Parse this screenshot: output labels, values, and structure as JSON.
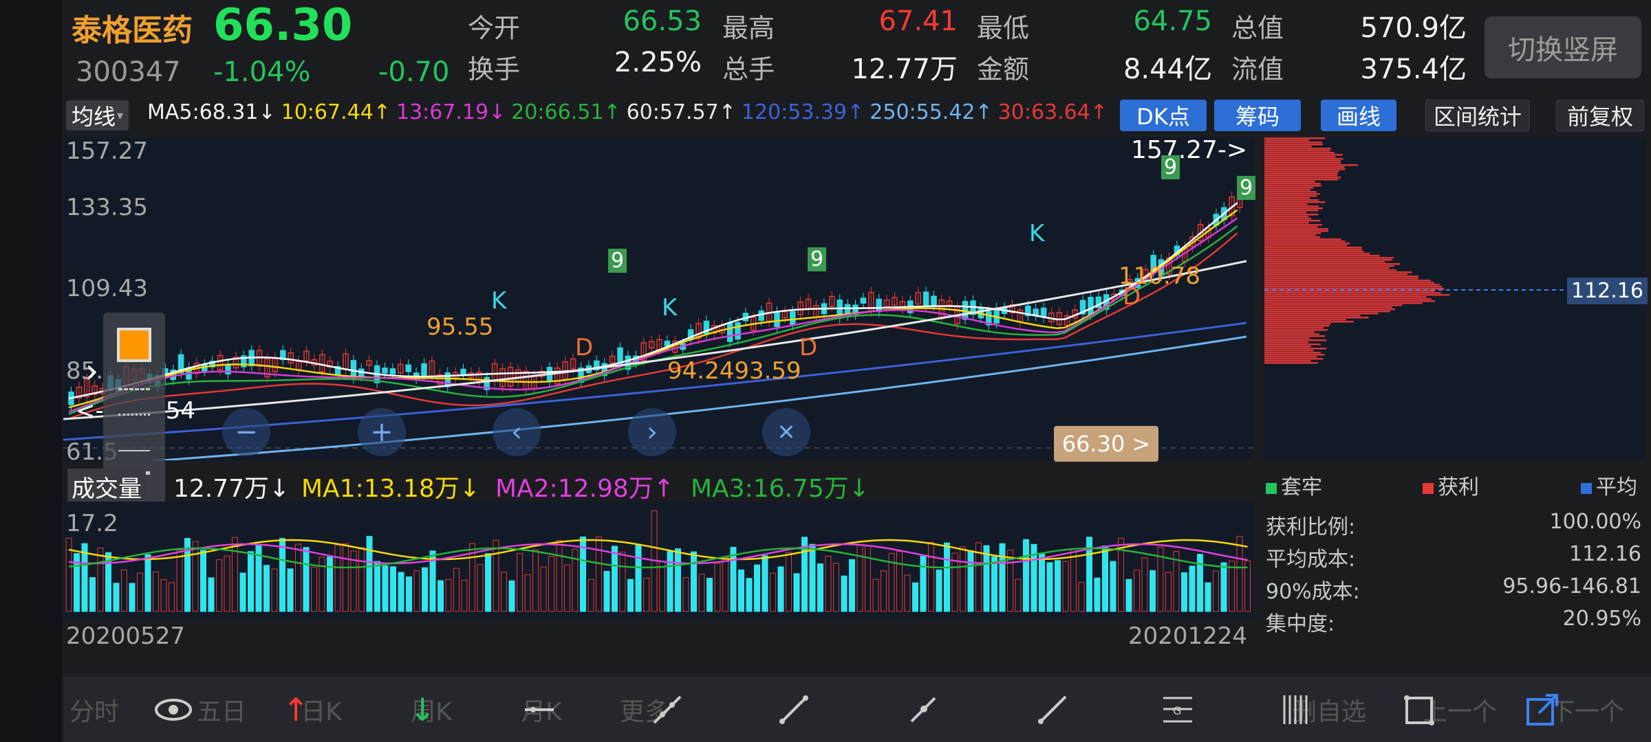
{
  "header": {
    "stock_name": "泰格医药",
    "price": "66.30",
    "code": "300347",
    "change_pct": "-1.04%",
    "change_amt": "-0.70",
    "fields": [
      {
        "label": "今开",
        "value": "66.53",
        "color": "#22c55e"
      },
      {
        "label": "最高",
        "value": "67.41",
        "color": "#ff3b30"
      },
      {
        "label": "最低",
        "value": "64.75",
        "color": "#22c55e"
      },
      {
        "label": "总值",
        "value": "570.9亿",
        "color": "#f2f2f2"
      },
      {
        "label": "换手",
        "value": "2.25%",
        "color": "#f2f2f2"
      },
      {
        "label": "总手",
        "value": "12.77万",
        "color": "#f2f2f2"
      },
      {
        "label": "金额",
        "value": "8.44亿",
        "color": "#f2f2f2"
      },
      {
        "label": "流值",
        "value": "375.4亿",
        "color": "#f2f2f2"
      }
    ],
    "switch_button": "切换竖屏"
  },
  "toolbar": {
    "ma_select": "均线",
    "ma_values": [
      {
        "text": "MA5:68.31↓",
        "color": "#f2f2f2"
      },
      {
        "text": "10:67.44↑",
        "color": "#f5d90a"
      },
      {
        "text": "13:67.19↓",
        "color": "#d63bd6"
      },
      {
        "text": "20:66.51↑",
        "color": "#27b33b"
      },
      {
        "text": "60:57.57↑",
        "color": "#e8e8e8"
      },
      {
        "text": "120:53.39↑",
        "color": "#3c62d8"
      },
      {
        "text": "250:55.42↑",
        "color": "#6fb4f0"
      },
      {
        "text": "30:63.64↑",
        "color": "#e53935"
      }
    ],
    "buttons": [
      "DK点",
      "筹码",
      "画线",
      "区间统计",
      "前复权"
    ]
  },
  "price_axis": [
    "157.27",
    "133.35",
    "109.43",
    "85.",
    "61.5"
  ],
  "annotations": {
    "high_marker": "157.27->",
    "low_left": "<-",
    "low_left_value": "54",
    "label_95": "95.55",
    "label_94": "94.24",
    "label_93": "93.59",
    "label_110": "110.78",
    "current_price": "66.30 >",
    "k_label": "K",
    "d_label": "D",
    "nine": "9"
  },
  "volume": {
    "label": "成交量",
    "value": "12.77万↓",
    "ma1": "MA1:13.18万↓",
    "ma2": "MA2:12.98万↑",
    "ma3": "MA3:16.75万↓",
    "axis_top": "17.2",
    "date_start": "20200527",
    "date_end": "20201224"
  },
  "chips": {
    "price_tag": "112.16",
    "legend": [
      "套牢",
      "获利",
      "平均"
    ],
    "legend_colors": [
      "#22c55e",
      "#e53935",
      "#2d6fd6"
    ],
    "stats": [
      {
        "label": "获利比例:",
        "value": "100.00%"
      },
      {
        "label": "平均成本:",
        "value": "112.16"
      },
      {
        "label": "90%成本:",
        "value": "95.96-146.81"
      },
      {
        "label": "集中度:",
        "value": "20.95%"
      }
    ]
  },
  "bottom_nav": {
    "tabs": [
      "分时",
      "五日",
      "日K",
      "周K",
      "月K",
      "更多"
    ],
    "right_tabs": [
      "删自选",
      "上一个",
      "下一个"
    ]
  },
  "icons": [
    "eye-icon",
    "arrow-up-icon",
    "arrow-down-icon",
    "line-tool-icon",
    "diagonal-line-icon",
    "segment-icon",
    "ray-icon",
    "fibonacci-icon",
    "parallel-lines-icon",
    "rectangle-icon",
    "share-icon"
  ],
  "chart_data": {
    "type": "candlestick",
    "x_range": [
      "20200527",
      "20201224"
    ],
    "y_range": [
      61.5,
      157.27
    ],
    "moving_averages": [
      "MA5",
      "MA10",
      "MA13",
      "MA20",
      "MA60",
      "MA120",
      "MA250",
      "MA30"
    ]
  }
}
